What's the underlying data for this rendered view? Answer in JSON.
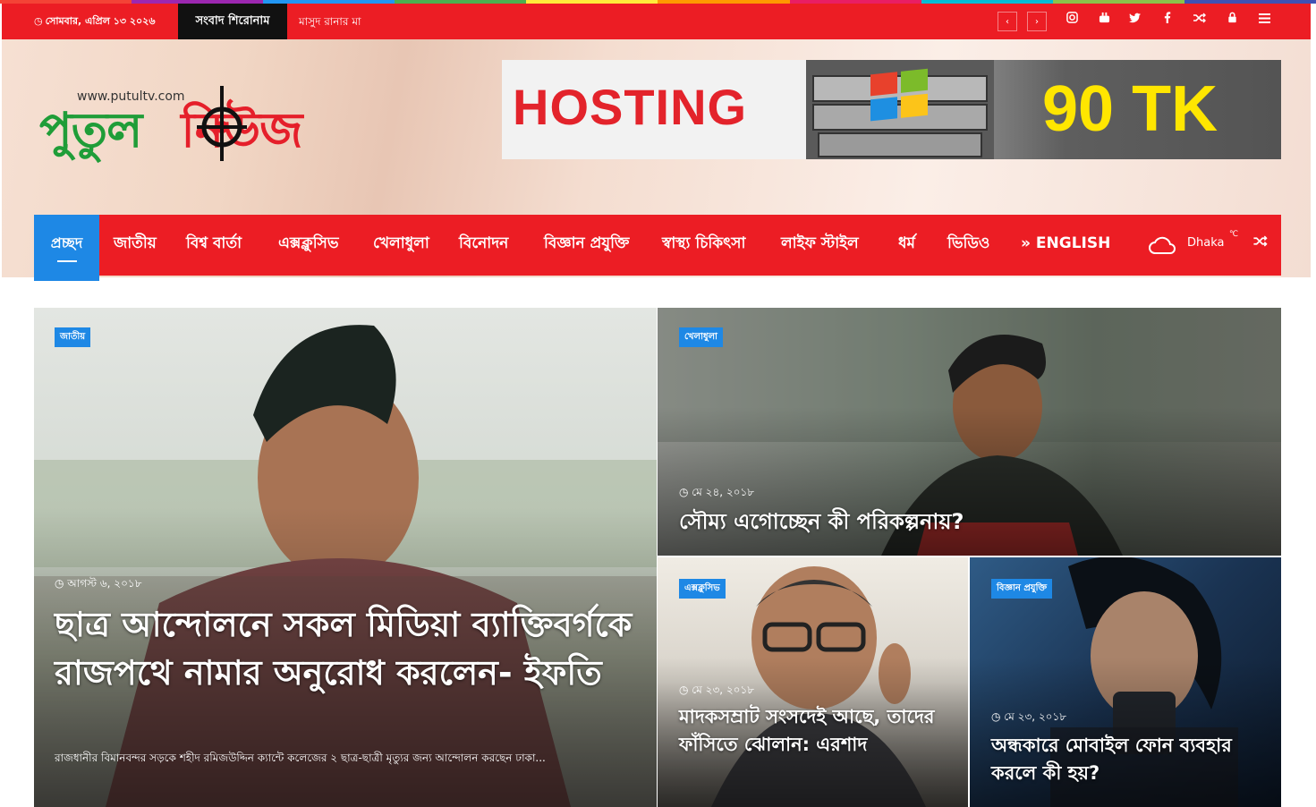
{
  "topbar": {
    "date_icon": "clock-icon",
    "date": "সোমবার, এপ্রিল ১৩ ২০২৬",
    "breaking_label": "সংবাদ শিরোনাম",
    "breaking_text": "মাসুদ রানার মা",
    "prev_icon": "chevron-left-icon",
    "next_icon": "chevron-right-icon",
    "social_icons": [
      "instagram-icon",
      "youtube-icon",
      "twitter-icon",
      "facebook-icon",
      "random-icon",
      "lock-icon",
      "menu-icon"
    ],
    "strip_colors": [
      "#f44336",
      "#9c27b0",
      "#2196f3",
      "#4caf50",
      "#ffeb3b",
      "#ff9800",
      "#e91e63",
      "#00bcd4",
      "#8bc34a",
      "#3f51b5"
    ]
  },
  "header": {
    "site_url": "www.putultv.com",
    "logo_part1": "পুতুল",
    "logo_part2": "নিউজ",
    "banner_text": "HOSTING",
    "banner_price": "90 TK"
  },
  "nav": {
    "items": [
      "প্রচ্ছদ",
      "জাতীয়",
      "বিশ্ব বার্তা",
      "এক্সক্লুসিভ",
      "খেলাধুলা",
      "বিনোদন",
      "বিজ্ঞান প্রযুক্তি",
      "স্বাস্থ্য চিকিৎসা",
      "লাইফ স্টাইল",
      "ধর্ম",
      "ভিডিও",
      "» ENGLISH"
    ],
    "weather_city": "Dhaka",
    "weather_unit": "℃",
    "weather_icon": "cloud-icon",
    "random_icon": "random-icon"
  },
  "posts": [
    {
      "category": "জাতীয়",
      "date": "আগস্ট ৬, ২০১৮",
      "title": "ছাত্র আন্দোলনে সকল মিডিয়া ব্যাক্তিবর্গকে রাজপথে নামার অনুরোধ করলেন- ইফতি",
      "excerpt": "রাজধানীর বিমানবন্দর সড়কে শহীদ রমিজউদ্দিন ক্যান্টে কলেজের ২ ছাত্র-ছাত্রী মৃত্যুর জন্য আন্দোলন করছেন ঢাকা..."
    },
    {
      "category": "খেলাধুলা",
      "date": "মে ২৪, ২০১৮",
      "title": "সৌম্য এগোচ্ছেন কী পরিকল্পনায়?"
    },
    {
      "category": "এক্সক্লুসিভ",
      "date": "মে ২৩, ২০১৮",
      "title": "মাদকসম্রাট সংসদেই আছে, তাদের ফাঁসিতে ঝোলান: এরশাদ"
    },
    {
      "category": "বিজ্ঞান প্রযুক্তি",
      "date": "মে ২৩, ২০১৮",
      "title": "অন্ধকারে মোবাইল ফোন ব্যবহার করলে কী হয়?"
    }
  ]
}
